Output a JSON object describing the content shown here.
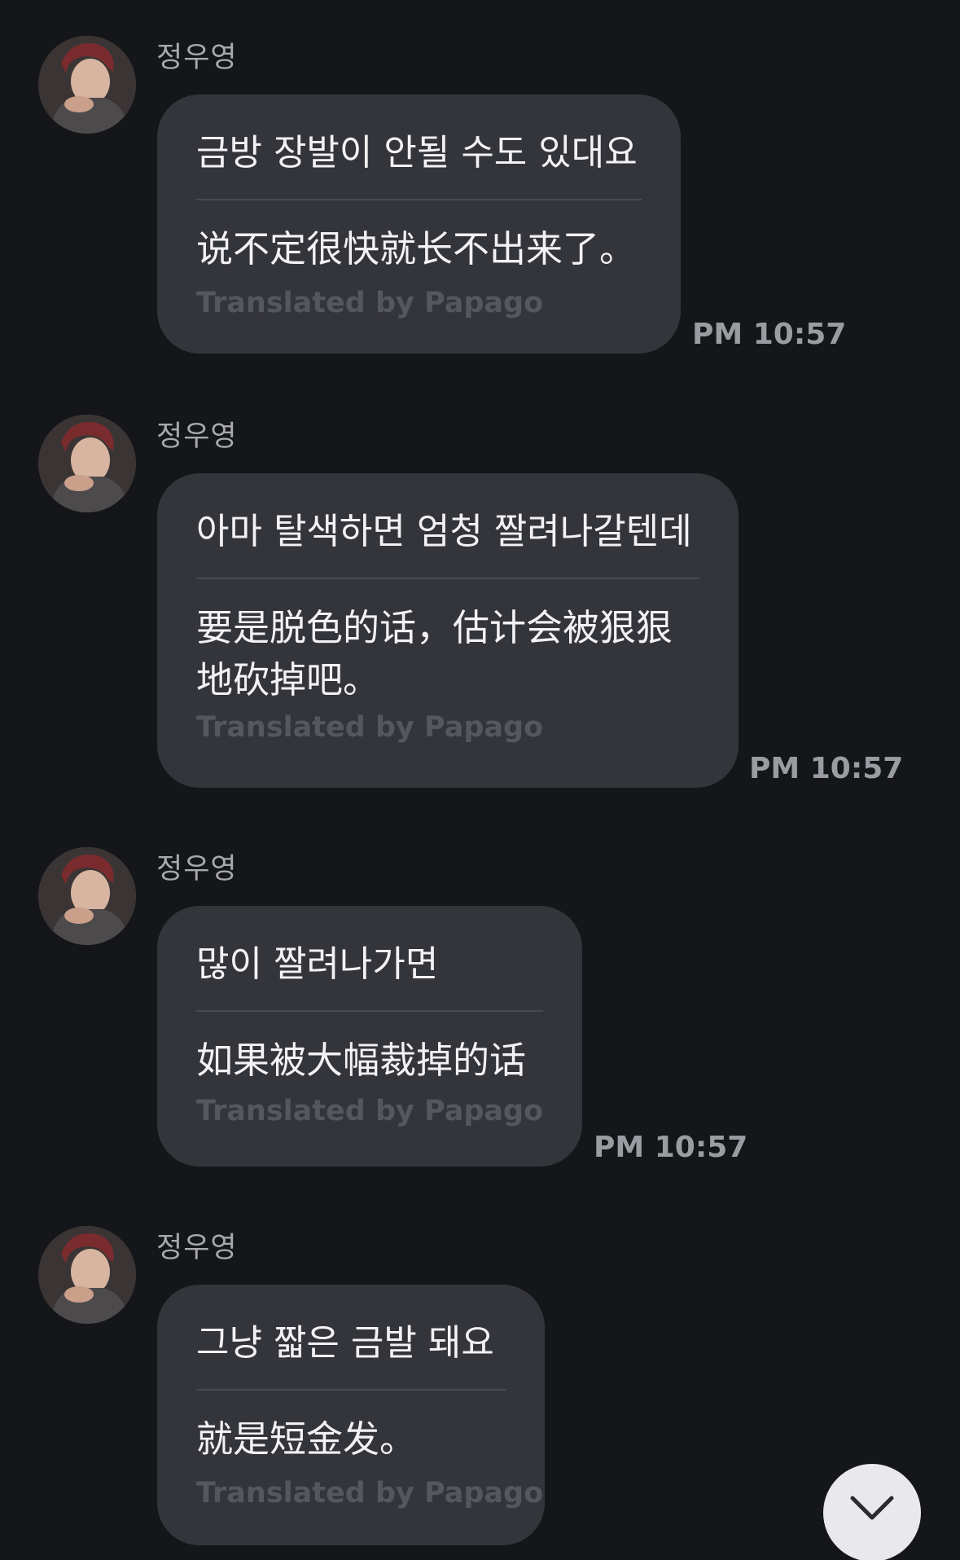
{
  "messages": [
    {
      "sender": "정우영",
      "original": "금방 장발이 안될 수도 있대요",
      "translated": "说不定很快就长不出来了。",
      "credit": "Translated by Papago",
      "time": "PM 10:57"
    },
    {
      "sender": "정우영",
      "original": "아마 탈색하면 엄청 짤려나갈텐데",
      "translated": "要是脱色的话，估计会被狠狠地砍掉吧。",
      "credit": "Translated by Papago",
      "time": "PM 10:57"
    },
    {
      "sender": "정우영",
      "original": "많이 짤려나가면",
      "translated": "如果被大幅裁掉的话",
      "credit": "Translated by Papago",
      "time": "PM 10:57"
    },
    {
      "sender": "정우영",
      "original": "그냥 짧은 금발 돼요",
      "translated": "就是短金发。",
      "credit": "Translated by Papago",
      "time": ""
    }
  ],
  "scroll_button": {
    "icon": "chevron-down-icon"
  },
  "colors": {
    "background": "#151619",
    "bubble": "#34353b",
    "text": "#f2f2f4",
    "muted": "#55575e",
    "time": "#9a9ca2"
  }
}
